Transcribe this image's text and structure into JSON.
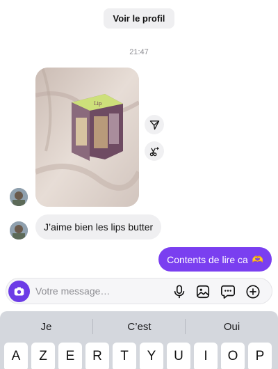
{
  "header": {
    "profile_button_label": "Voir le profil"
  },
  "timestamp": "21:47",
  "messages": {
    "photo": {
      "icon_share": "share-icon",
      "icon_scissors": "scissors-sparkle-icon"
    },
    "incoming_text": "J’aime bien les lips butter",
    "outgoing_text": "Contents de lire ca",
    "outgoing_emoji": "🫶"
  },
  "composer": {
    "placeholder": "Votre message…",
    "icons": [
      "camera-icon",
      "microphone-icon",
      "gallery-icon",
      "sticker-icon",
      "add-icon"
    ]
  },
  "keyboard": {
    "suggestions": [
      "Je",
      "C’est",
      "Oui"
    ],
    "top_row": [
      "A",
      "Z",
      "E",
      "R",
      "T",
      "Y",
      "U",
      "I",
      "O",
      "P"
    ]
  },
  "colors": {
    "accent": "#7a3ff0",
    "camera_button": "#6c3ce6",
    "incoming_bubble": "#efeff1",
    "keyboard_bg": "#d4d7dd"
  }
}
